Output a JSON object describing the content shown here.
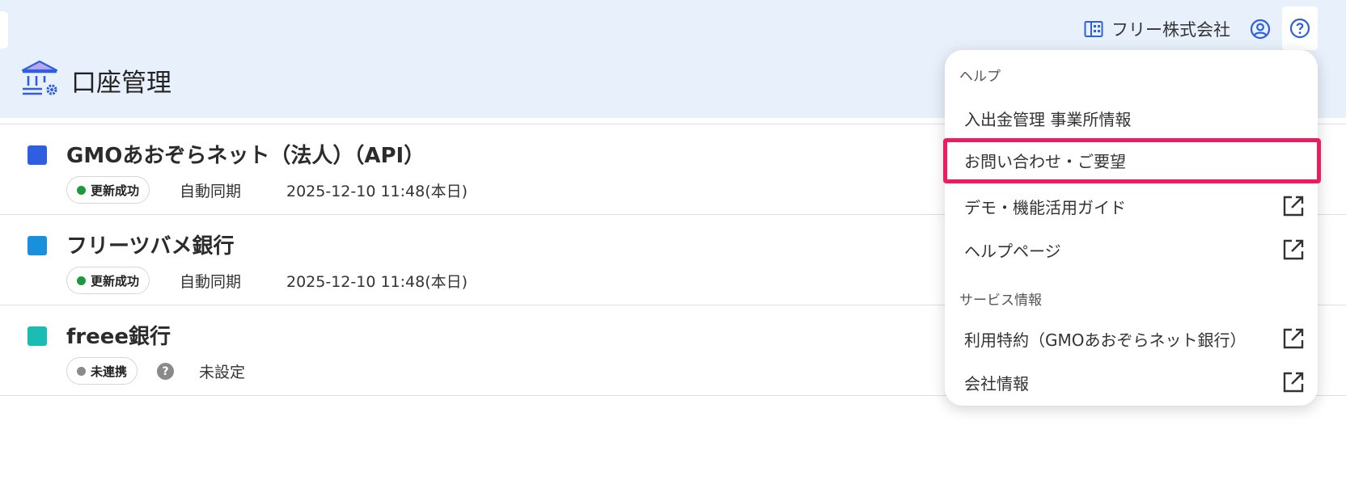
{
  "header": {
    "company_name": "フリー株式会社",
    "page_title": "口座管理"
  },
  "accounts": [
    {
      "name": "GMOあおぞらネット（法人）（API）",
      "color": "#2f5fe0",
      "status": "更新成功",
      "status_color": "#1a9a3a",
      "sync": "自動同期",
      "date": "2025-12-10 11:48(本日)"
    },
    {
      "name": "フリーツバメ銀行",
      "color": "#1a8fdc",
      "status": "更新成功",
      "status_color": "#1a9a3a",
      "sync": "自動同期",
      "date": "2025-12-10 11:48(本日)"
    },
    {
      "name": "freee銀行",
      "color": "#1bbcb3",
      "status": "未連携",
      "status_color": "#8a8a8a",
      "help_mark": "?",
      "setting": "未設定"
    }
  ],
  "help_menu": {
    "section_help": "ヘルプ",
    "items_help": [
      {
        "label": "入出金管理 事業所情報",
        "external": false
      },
      {
        "label": "お問い合わせ・ご要望",
        "external": false,
        "highlighted": true
      },
      {
        "label": "デモ・機能活用ガイド",
        "external": true
      },
      {
        "label": "ヘルプページ",
        "external": true
      }
    ],
    "section_service": "サービス情報",
    "items_service": [
      {
        "label": "利用特約（GMOあおぞらネット銀行）",
        "external": true
      },
      {
        "label": "会社情報",
        "external": true
      }
    ]
  },
  "icons": {
    "company": "building-icon",
    "user": "user-circle-icon",
    "help": "question-circle-icon",
    "page": "bank-settings-icon",
    "external": "external-link-icon"
  },
  "colors": {
    "header_bg": "#e8f0fb",
    "accent_blue": "#2f5fe0",
    "highlight": "#ee1c5f"
  }
}
